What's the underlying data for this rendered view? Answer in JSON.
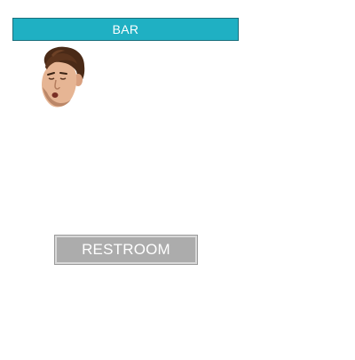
{
  "buttons": {
    "bar_label": "BAR",
    "restroom_label": "RESTROOM"
  },
  "avatar": {
    "icon": "face-head-icon"
  },
  "colors": {
    "bar_bg": "#1fb0c3",
    "bar_border": "#1a6f7c",
    "restroom_bg": "#acacac",
    "text": "#ffffff"
  }
}
